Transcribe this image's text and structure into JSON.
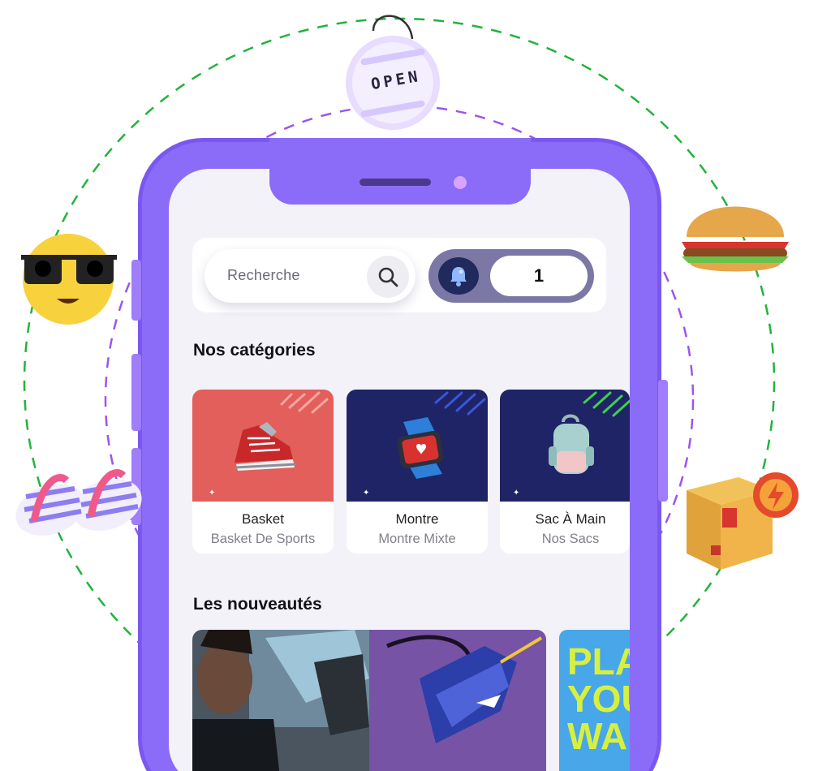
{
  "open_sign": {
    "text": "OPEN"
  },
  "header": {
    "search_placeholder": "Recherche",
    "notification_count": "1"
  },
  "categories": {
    "title": "Nos catégories",
    "items": [
      {
        "title": "Basket",
        "subtitle": "Basket De Sports",
        "bg": "#e25f5b"
      },
      {
        "title": "Montre",
        "subtitle": "Montre Mixte",
        "bg": "#1e2466"
      },
      {
        "title": "Sac À Main",
        "subtitle": "Nos Sacs",
        "bg": "#1e2466"
      }
    ]
  },
  "news": {
    "title": "Les nouveautés",
    "poster_lines": [
      "PLA",
      "YOU",
      "WA"
    ]
  },
  "colors": {
    "phone": "#8b6cf8",
    "orbit_outer": "#22b33a",
    "orbit_inner": "#9b55ee"
  }
}
